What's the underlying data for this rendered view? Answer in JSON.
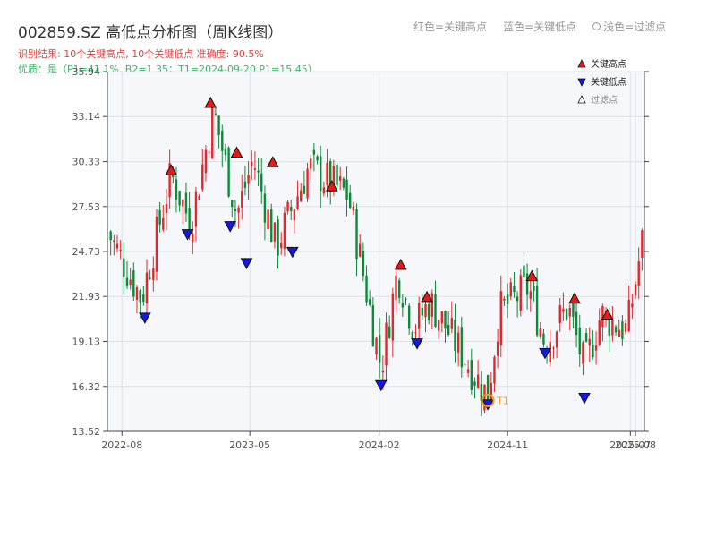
{
  "header": {
    "title": "002859.SZ 高低点分析图（周K线图）",
    "result_line": "识别结果: 10个关键高点, 10个关键低点  准确度: 90.5%",
    "quality_line": "优质：是（P1=41.1%, B2=1.35；T1=2024-09-20 P1=15.45）",
    "legend_red": "红色=关键高点",
    "legend_blue": "蓝色=关键低点",
    "legend_light": "浅色=过滤点"
  },
  "colors": {
    "up": "#e0292c",
    "down": "#0b8a38",
    "high_marker": "#e8191a",
    "low_marker": "#1418e6",
    "t1_marker": "#f0a020",
    "plot_bg": "#f5f7fa",
    "grid": "#dde1e6"
  },
  "chart_data": {
    "type": "candlestick",
    "title": "",
    "ylim": [
      13.52,
      35.94
    ],
    "y_ticks": [
      "13.52",
      "16.32",
      "19.13",
      "21.93",
      "24.73",
      "27.53",
      "30.33",
      "33.14",
      "35.94"
    ],
    "x_range": [
      "2022-07-01",
      "2025-08-20"
    ],
    "x_ticks": [
      {
        "date": "2022-08-01",
        "label": "2022-08"
      },
      {
        "date": "2023-05-01",
        "label": "2023-05"
      },
      {
        "date": "2024-02-01",
        "label": "2024-02"
      },
      {
        "date": "2024-11-01",
        "label": "2024-11"
      },
      {
        "date": "2025-07-21",
        "label": "2025-07"
      },
      {
        "date": "2025-08-01",
        "label": "2025-08"
      }
    ],
    "legend": [
      "关键高点",
      "关键低点",
      "过滤点"
    ],
    "candle_anchors": [
      {
        "date": "2022-07-01",
        "close": 26.0
      },
      {
        "date": "2022-09-12",
        "close": 21.8
      },
      {
        "date": "2022-11-14",
        "close": 29.5
      },
      {
        "date": "2022-12-26",
        "close": 26.5
      },
      {
        "date": "2023-02-13",
        "close": 33.5
      },
      {
        "date": "2023-04-03",
        "close": 27.0
      },
      {
        "date": "2023-05-08",
        "close": 30.5
      },
      {
        "date": "2023-06-26",
        "close": 25.0
      },
      {
        "date": "2023-09-04",
        "close": 30.0
      },
      {
        "date": "2023-11-27",
        "close": 28.2
      },
      {
        "date": "2024-02-05",
        "close": 17.5
      },
      {
        "date": "2024-03-11",
        "close": 23.5
      },
      {
        "date": "2024-04-15",
        "close": 20.0
      },
      {
        "date": "2024-05-20",
        "close": 21.6
      },
      {
        "date": "2024-09-20",
        "close": 15.7
      },
      {
        "date": "2024-10-14",
        "close": 21.0
      },
      {
        "date": "2024-12-16",
        "close": 22.5
      },
      {
        "date": "2025-01-20",
        "close": 19.0
      },
      {
        "date": "2025-03-10",
        "close": 21.3
      },
      {
        "date": "2025-04-14",
        "close": 17.5
      },
      {
        "date": "2025-05-19",
        "close": 20.8
      },
      {
        "date": "2025-07-14",
        "close": 19.8
      },
      {
        "date": "2025-08-18",
        "close": 25.8
      }
    ],
    "key_highs": [
      {
        "date": "2022-11-14",
        "price": 29.4
      },
      {
        "date": "2023-02-06",
        "price": 33.6
      },
      {
        "date": "2023-04-03",
        "price": 30.5
      },
      {
        "date": "2023-06-19",
        "price": 29.9
      },
      {
        "date": "2023-10-23",
        "price": 28.4
      },
      {
        "date": "2024-03-18",
        "price": 23.5
      },
      {
        "date": "2024-05-13",
        "price": 21.5
      },
      {
        "date": "2024-12-23",
        "price": 22.8
      },
      {
        "date": "2025-03-24",
        "price": 21.4
      },
      {
        "date": "2025-06-02",
        "price": 20.4
      }
    ],
    "key_lows": [
      {
        "date": "2022-09-19",
        "price": 21.0
      },
      {
        "date": "2022-12-19",
        "price": 26.2
      },
      {
        "date": "2023-03-20",
        "price": 26.7
      },
      {
        "date": "2023-04-24",
        "price": 24.4
      },
      {
        "date": "2023-07-31",
        "price": 25.1
      },
      {
        "date": "2024-02-05",
        "price": 16.8
      },
      {
        "date": "2024-04-22",
        "price": 19.4
      },
      {
        "date": "2024-09-20",
        "price": 15.6
      },
      {
        "date": "2025-01-20",
        "price": 18.8
      },
      {
        "date": "2025-04-14",
        "price": 16.0
      }
    ],
    "t1": {
      "date": "2024-09-20",
      "price": 15.45,
      "label": "T1"
    }
  }
}
